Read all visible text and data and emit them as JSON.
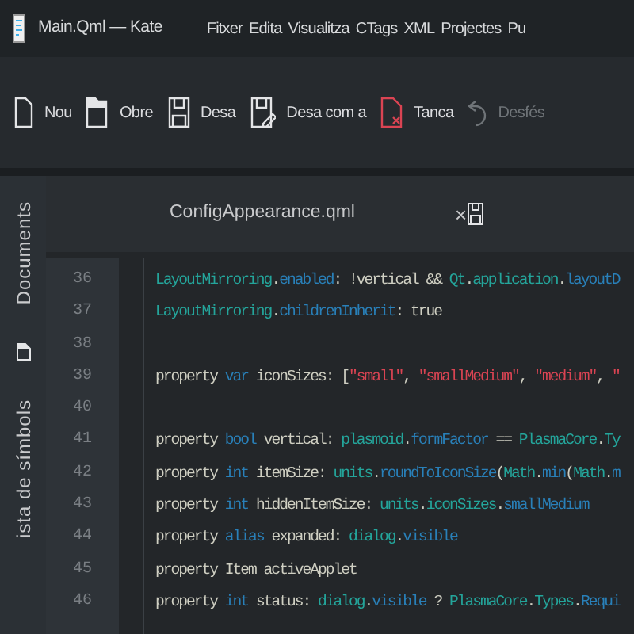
{
  "window": {
    "title": "Main.Qml — Kate"
  },
  "menu": [
    "Fitxer",
    "Edita",
    "Visualitza",
    "CTags",
    "XML",
    "Projectes",
    "Pu"
  ],
  "toolbar": [
    {
      "kind": "new",
      "label": "Nou",
      "disabled": false
    },
    {
      "kind": "open",
      "label": "Obre",
      "disabled": false
    },
    {
      "kind": "save",
      "label": "Desa",
      "disabled": false
    },
    {
      "kind": "saveas",
      "label": "Desa com a",
      "disabled": false
    },
    {
      "kind": "close",
      "label": "Tanca",
      "disabled": false
    },
    {
      "kind": "undo",
      "label": "Desfés",
      "disabled": true
    }
  ],
  "sidebar": [
    {
      "kind": "text",
      "label": "Documents"
    },
    {
      "kind": "icon"
    },
    {
      "kind": "text",
      "label": "ista de símbols"
    }
  ],
  "tab": {
    "label": "ConfigAppearance.qml",
    "close": "×",
    "modified": true
  },
  "editor": {
    "lines": [
      {
        "number": "36",
        "tokens": [
          {
            "kind": "ident",
            "text": "LayoutMirroring"
          },
          {
            "kind": "text",
            "text": "."
          },
          {
            "kind": "member",
            "text": "enabled"
          },
          {
            "kind": "text",
            "text": ": !vertical && "
          },
          {
            "kind": "ident",
            "text": "Qt"
          },
          {
            "kind": "text",
            "text": "."
          },
          {
            "kind": "ident",
            "text": "application"
          },
          {
            "kind": "text",
            "text": "."
          },
          {
            "kind": "member",
            "text": "layoutD"
          }
        ]
      },
      {
        "number": "37",
        "tokens": [
          {
            "kind": "ident",
            "text": "LayoutMirroring"
          },
          {
            "kind": "text",
            "text": "."
          },
          {
            "kind": "member",
            "text": "childrenInherit"
          },
          {
            "kind": "text",
            "text": ": true"
          }
        ]
      },
      {
        "number": "38"
      },
      {
        "number": "39",
        "tokens": [
          {
            "kind": "text",
            "text": "property "
          },
          {
            "kind": "type",
            "text": "var"
          },
          {
            "kind": "text",
            "text": " iconSizes: ["
          },
          {
            "kind": "string",
            "text": "\"small\""
          },
          {
            "kind": "text",
            "text": ", "
          },
          {
            "kind": "string",
            "text": "\"smallMedium\""
          },
          {
            "kind": "text",
            "text": ", "
          },
          {
            "kind": "string",
            "text": "\"medium\""
          },
          {
            "kind": "text",
            "text": ", "
          },
          {
            "kind": "string",
            "text": "\""
          }
        ]
      },
      {
        "number": "40"
      },
      {
        "number": "41",
        "tokens": [
          {
            "kind": "text",
            "text": "property "
          },
          {
            "kind": "type",
            "text": "bool"
          },
          {
            "kind": "text",
            "text": " vertical: "
          },
          {
            "kind": "ident",
            "text": "plasmoid"
          },
          {
            "kind": "text",
            "text": "."
          },
          {
            "kind": "member",
            "text": "formFactor"
          },
          {
            "kind": "text",
            "text": " == "
          },
          {
            "kind": "ident",
            "text": "PlasmaCore"
          },
          {
            "kind": "text",
            "text": "."
          },
          {
            "kind": "ident",
            "text": "Ty"
          }
        ]
      },
      {
        "number": "42",
        "tokens": [
          {
            "kind": "text",
            "text": "property "
          },
          {
            "kind": "type",
            "text": "int"
          },
          {
            "kind": "text",
            "text": " itemSize: "
          },
          {
            "kind": "ident",
            "text": "units"
          },
          {
            "kind": "text",
            "text": "."
          },
          {
            "kind": "member",
            "text": "roundToIconSize"
          },
          {
            "kind": "text",
            "text": "("
          },
          {
            "kind": "ident",
            "text": "Math"
          },
          {
            "kind": "text",
            "text": "."
          },
          {
            "kind": "member",
            "text": "min"
          },
          {
            "kind": "text",
            "text": "("
          },
          {
            "kind": "ident",
            "text": "Math"
          },
          {
            "kind": "text",
            "text": "."
          },
          {
            "kind": "member",
            "text": "m"
          }
        ]
      },
      {
        "number": "43",
        "tokens": [
          {
            "kind": "text",
            "text": "property "
          },
          {
            "kind": "type",
            "text": "int"
          },
          {
            "kind": "text",
            "text": " hiddenItemSize: "
          },
          {
            "kind": "ident",
            "text": "units"
          },
          {
            "kind": "text",
            "text": "."
          },
          {
            "kind": "ident",
            "text": "iconSizes"
          },
          {
            "kind": "text",
            "text": "."
          },
          {
            "kind": "member",
            "text": "smallMedium"
          }
        ]
      },
      {
        "number": "44",
        "tokens": [
          {
            "kind": "text",
            "text": "property "
          },
          {
            "kind": "type",
            "text": "alias"
          },
          {
            "kind": "text",
            "text": " expanded: "
          },
          {
            "kind": "ident",
            "text": "dialog"
          },
          {
            "kind": "text",
            "text": "."
          },
          {
            "kind": "member",
            "text": "visible"
          }
        ]
      },
      {
        "number": "45",
        "tokens": [
          {
            "kind": "text",
            "text": "property Item activeApplet"
          }
        ]
      },
      {
        "number": "46",
        "tokens": [
          {
            "kind": "text",
            "text": "property "
          },
          {
            "kind": "type",
            "text": "int"
          },
          {
            "kind": "text",
            "text": " status: "
          },
          {
            "kind": "ident",
            "text": "dialog"
          },
          {
            "kind": "text",
            "text": "."
          },
          {
            "kind": "member",
            "text": "visible"
          },
          {
            "kind": "text",
            "text": " ? "
          },
          {
            "kind": "ident",
            "text": "PlasmaCore"
          },
          {
            "kind": "text",
            "text": "."
          },
          {
            "kind": "ident",
            "text": "Types"
          },
          {
            "kind": "text",
            "text": "."
          },
          {
            "kind": "member",
            "text": "Requi"
          }
        ]
      }
    ]
  }
}
